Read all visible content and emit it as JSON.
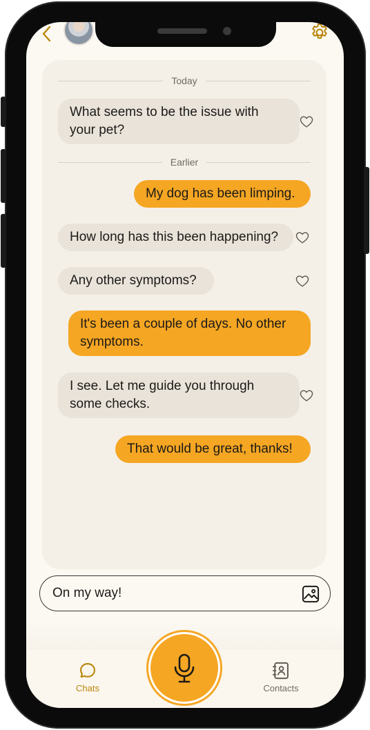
{
  "header": {
    "back_icon": "chevron-left-icon",
    "settings_icon": "gear-icon"
  },
  "chat": {
    "dividers": [
      "Today",
      "Earlier"
    ],
    "messages": [
      {
        "from": "vet",
        "text_lines": [
          "What seems to be the issue with",
          "your pet?"
        ]
      },
      {
        "from": "user",
        "text_lines": [
          "My dog has been limping."
        ]
      },
      {
        "from": "vet",
        "text_lines": [
          "How long has this been happening?"
        ]
      },
      {
        "from": "vet",
        "text_lines": [
          "Any other symptoms?"
        ]
      },
      {
        "from": "user",
        "text_lines": [
          "It's been a couple of days. No other",
          "symptoms."
        ]
      },
      {
        "from": "vet",
        "text_lines": [
          "I see. Let me guide you through",
          "some checks."
        ]
      },
      {
        "from": "user",
        "text_lines": [
          "That would be great, thanks!"
        ]
      }
    ]
  },
  "composer": {
    "value": "On my way!",
    "image_icon": "image-icon"
  },
  "tabbar": {
    "chats_label": "Chats",
    "contacts_label": "Contacts",
    "mic_icon": "microphone-icon"
  },
  "colors": {
    "accent": "#f5a623",
    "accent_dark": "#b8860b",
    "incoming_bubble": "#e9e3da",
    "background": "#fcf9f3"
  }
}
